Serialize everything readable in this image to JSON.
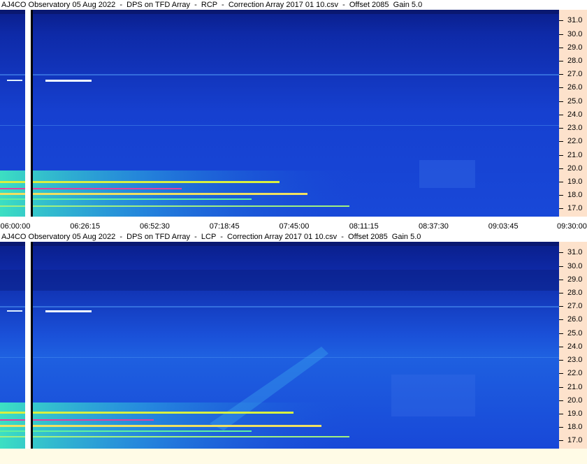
{
  "panels": [
    {
      "title": "AJ4CO Observatory 05 Aug 2022  -  DPS on TFD Array  -  RCP  -  Correction Array 2017 01 10.csv  -  Offset 2085  Gain 5.0"
    },
    {
      "title": "AJ4CO Observatory 05 Aug 2022  -  DPS on TFD Array  -  LCP  -  Correction Array 2017 01 10.csv  -  Offset 2085  Gain 5.0"
    }
  ],
  "chart_data": {
    "type": "heatmap",
    "panels": [
      "RCP",
      "LCP"
    ],
    "x_ticks": [
      "06:00:00",
      "06:26:15",
      "06:52:30",
      "07:18:45",
      "07:45:00",
      "08:11:15",
      "08:37:30",
      "09:03:45",
      "09:30:00"
    ],
    "y_ticks": [
      "31.0",
      "30.0",
      "29.0",
      "28.0",
      "27.0",
      "26.0",
      "25.0",
      "24.0",
      "23.0",
      "22.0",
      "21.0",
      "20.0",
      "19.0",
      "18.0",
      "17.0"
    ],
    "ylim": [
      16.4,
      31.8
    ],
    "colors": {
      "background": "#1238c8",
      "frame": "#fde2cc"
    }
  }
}
